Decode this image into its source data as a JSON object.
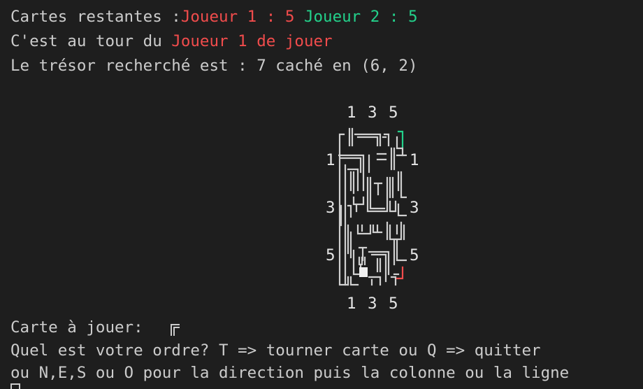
{
  "status": {
    "cards_prefix": "Cartes restantes :",
    "player1_cards": "Joueur 1 : 5",
    "player2_cards": "Joueur 2 : 5",
    "turn_prefix": "C'est au tour du ",
    "turn_player": "Joueur 1 de jouer",
    "treasure_line": "Le trésor recherché est : 7 caché en (6, 2)"
  },
  "board": {
    "col_labels_top": [
      "1",
      "3",
      "5"
    ],
    "col_labels_bottom": [
      "1",
      "3",
      "5"
    ],
    "row_labels_left": [
      "1",
      "3",
      "5"
    ],
    "row_labels_right": [
      "1",
      "3",
      "5"
    ],
    "colors": {
      "player1": "#f14c4c",
      "player2": "#23d18b",
      "walls": "#d0d0d0"
    }
  },
  "prompt": {
    "card_label": "Carte à jouer: ",
    "card_glyph": "╔-tile-icon",
    "order_line": "Quel est votre ordre? T => tourner carte ou Q => quitter",
    "direction_line": "ou N,E,S ou O pour la direction puis la colonne ou la ligne"
  },
  "theme": {
    "background": "#1e1e1e",
    "foreground": "#cccccc"
  }
}
